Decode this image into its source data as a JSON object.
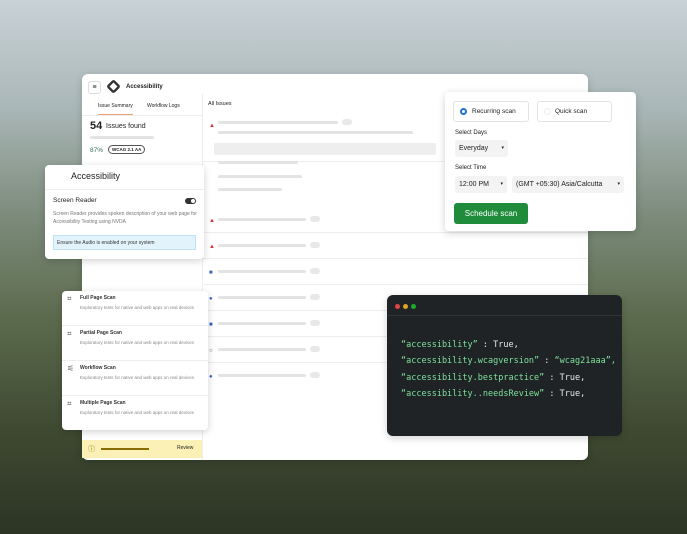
{
  "app": {
    "title": "Accessibility",
    "tabs": [
      "Issue Summary",
      "Workflow Logs"
    ],
    "issues_count": "54",
    "issues_label": "Issues found",
    "score": "87%",
    "badge": "WCAG 2.1 AA",
    "list_title": "All Issues",
    "review": "Review"
  },
  "a11y_card": {
    "title": "Accessibility",
    "section": "Screen Reader",
    "description": "Screen Reader provides spoken description of your web page for Accessibility Testing using NVDA",
    "notice": "Ensure the Audio is enabled on your system",
    "toggle_on": true
  },
  "scans": [
    {
      "title": "Full Page Scan",
      "desc": "Exploratory tests for native and web apps on real devices"
    },
    {
      "title": "Partial Page Scan",
      "desc": "Exploratory tests for native and web apps on real devices"
    },
    {
      "title": "Workflow Scan",
      "desc": "Exploratory tests for native and web apps on real devices"
    },
    {
      "title": "Multiple Page Scan",
      "desc": "Exploratory tests for native and web apps on real devices"
    }
  ],
  "schedule": {
    "recurring": "Recurring scan",
    "quick": "Quick scan",
    "days_label": "Select Days",
    "days": "Everyday",
    "time_label": "Select Time",
    "time": "12:00 PM",
    "timezone": "(GMT +05:30) Asia/Calcutta",
    "button": "Schedule scan"
  },
  "code": {
    "lines": [
      {
        "key": "“accessibility”",
        "sep": " : ",
        "val": "True,"
      },
      {
        "key": "“accessibility.wcagversion”",
        "sep": " : ",
        "val": "“wcag21aaa”,"
      },
      {
        "key": "“accessibility.bestpractice”",
        "sep": " : ",
        "val": "True,"
      },
      {
        "key": "“accessibility..needsReview”",
        "sep": " : ",
        "val": "True,"
      }
    ]
  }
}
